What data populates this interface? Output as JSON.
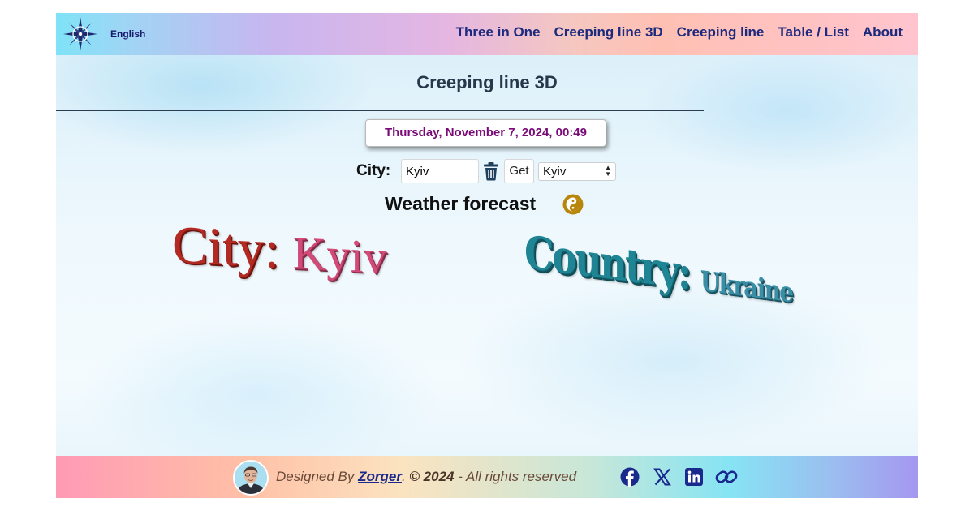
{
  "header": {
    "language_label": "English",
    "nav": [
      "Three in One",
      "Creeping line 3D",
      "Creeping line",
      "Table / List",
      "About"
    ]
  },
  "main": {
    "page_title": "Creeping line 3D",
    "datetime": "Thursday, November 7, 2024, 00:49",
    "city_label": "City:",
    "city_input_value": "Kyiv",
    "get_button_label": "Get",
    "city_select_value": "Kyiv",
    "forecast_heading": "Weather forecast"
  },
  "creeping_line": {
    "city_key": "City:",
    "city_value": "Kyiv",
    "country_key": "Country:",
    "country_value": "Ukraine"
  },
  "footer": {
    "designed_by": "Designed By ",
    "author": "Zorger",
    "separator": ". ",
    "copyright": "© 2024",
    "rights": " - All rights reserved"
  },
  "icons": [
    "compass-logo-icon",
    "trash-icon",
    "yin-yang-icon",
    "facebook-icon",
    "x-icon",
    "linkedin-icon",
    "link-icon"
  ],
  "colors": {
    "nav_text": "#1c2a7e",
    "date_text": "#7a0a78",
    "city_3d": "#b32a22",
    "country_3d": "#1f8595"
  }
}
